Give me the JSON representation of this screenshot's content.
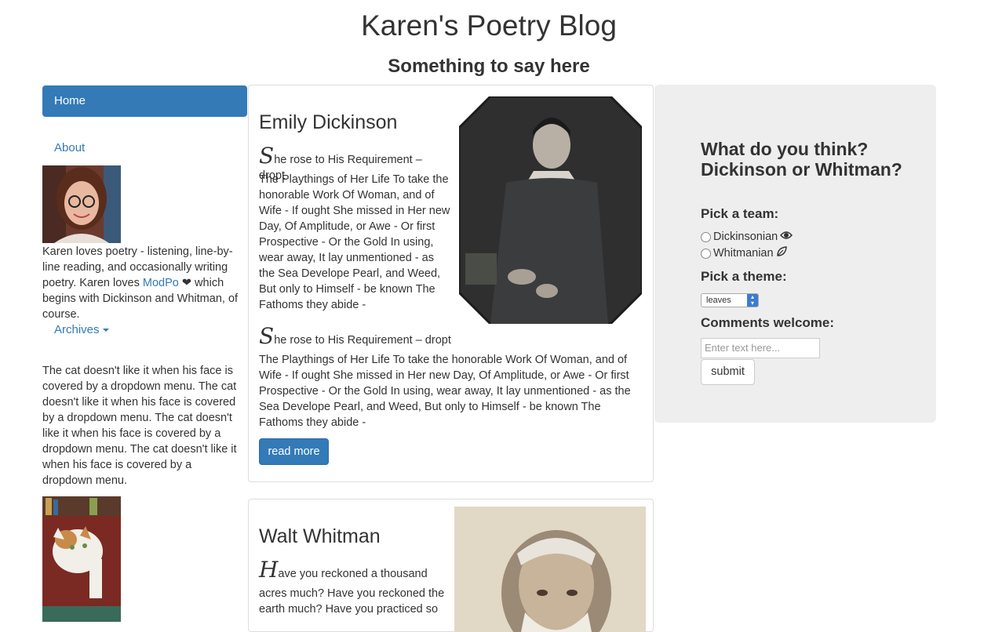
{
  "header": {
    "title": "Karen's Poetry Blog",
    "subtitle": "Something to say here"
  },
  "sidebar": {
    "nav": {
      "home": "Home",
      "about": "About",
      "archives": "Archives"
    },
    "bio_before_link": "Karen loves poetry - listening, line-by-line reading, and occasionally writing poetry. Karen loves ",
    "bio_link": "ModPo",
    "bio_after_link": " which begins with Dickinson and Whitman, of course.",
    "cat_text": "The cat doesn't like it when his face is covered by a dropdown menu. The cat doesn't like it when his face is covered by a dropdown menu. The cat doesn't like it when his face is covered by a dropdown menu. The cat doesn't like it when his face is covered by a dropdown menu."
  },
  "posts": [
    {
      "title": "Emily Dickinson",
      "drop_cap": "S",
      "first_line": "he rose to His Requirement – dropt",
      "body": "The Playthings of Her Life To take the honorable Work Of Woman, and of Wife - If ought She missed in Her new Day, Of Amplitude, or Awe - Or first Prospective - Or the Gold In using, wear away, It lay unmentioned - as the Sea Develope Pearl, and Weed, But only to Himself - be known The Fathoms they abide -",
      "drop_cap_2": "S",
      "first_line_2": "he rose to His Requirement – dropt",
      "body_2": "The Playthings of Her Life To take the honorable Work Of Woman, and of Wife - If ought She missed in Her new Day, Of Amplitude, or Awe - Or first Prospective - Or the Gold In using, wear away, It lay unmentioned - as the Sea Develope Pearl, and Weed, But only to Himself - be known The Fathoms they abide -",
      "button": "read more"
    },
    {
      "title": "Walt Whitman",
      "drop_cap": "H",
      "first_line": "ave you reckoned a thousand",
      "body": "acres much? Have you reckoned the earth much? Have you practiced so"
    }
  ],
  "sidebar_right": {
    "heading": "What do you think? Dickinson or Whitman?",
    "team_label": "Pick a team:",
    "team_options": [
      "Dickinsonian",
      "Whitmanian"
    ],
    "theme_label": "Pick a theme:",
    "theme_selected": "leaves",
    "comments_label": "Comments welcome:",
    "comments_placeholder": "Enter text here...",
    "submit_label": "submit"
  },
  "icons": {
    "heart": "heart-icon",
    "eye": "eye-icon",
    "leaf": "leaf-icon",
    "caret": "caret-down-icon"
  },
  "colors": {
    "link": "#337ab7",
    "primary_button": "#337ab7",
    "panel_bg": "#eeeeee"
  }
}
